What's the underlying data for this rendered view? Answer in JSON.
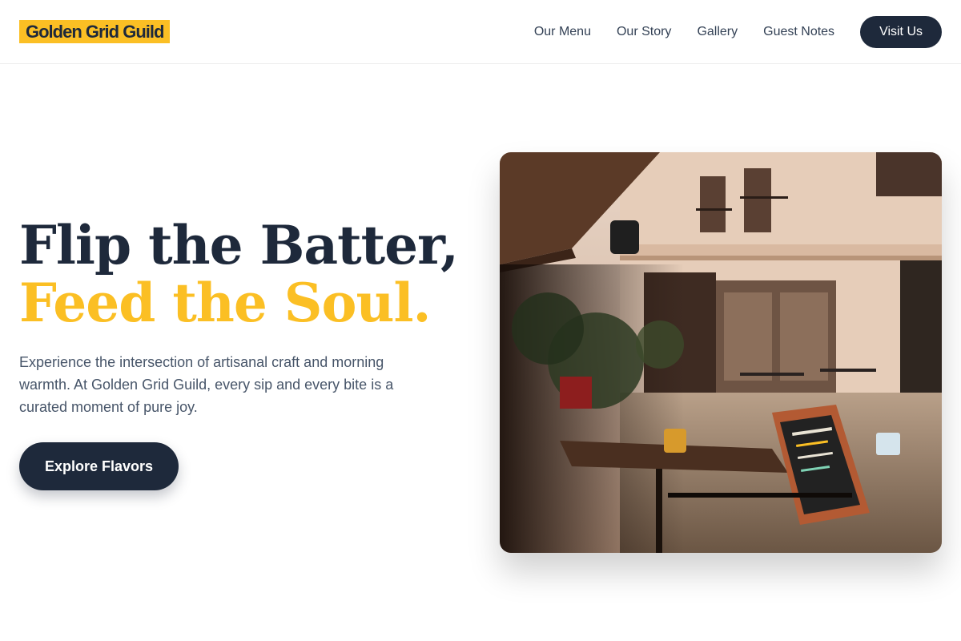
{
  "header": {
    "logo": "Golden Grid Guild",
    "nav": [
      "Our Menu",
      "Our Story",
      "Gallery",
      "Guest Notes"
    ],
    "cta": "Visit Us"
  },
  "hero": {
    "title_line1": "Flip the Batter,",
    "title_line2": "Feed the Soul.",
    "description": "Experience the intersection of artisanal craft and morning warmth. At Golden Grid Guild, every sip and every bite is a curated moment of pure joy.",
    "button": "Explore Flavors",
    "image_icon": "cafe-street-photo"
  },
  "colors": {
    "accent": "#fbbf24",
    "primary": "#1e293b",
    "text_muted": "#475569"
  }
}
